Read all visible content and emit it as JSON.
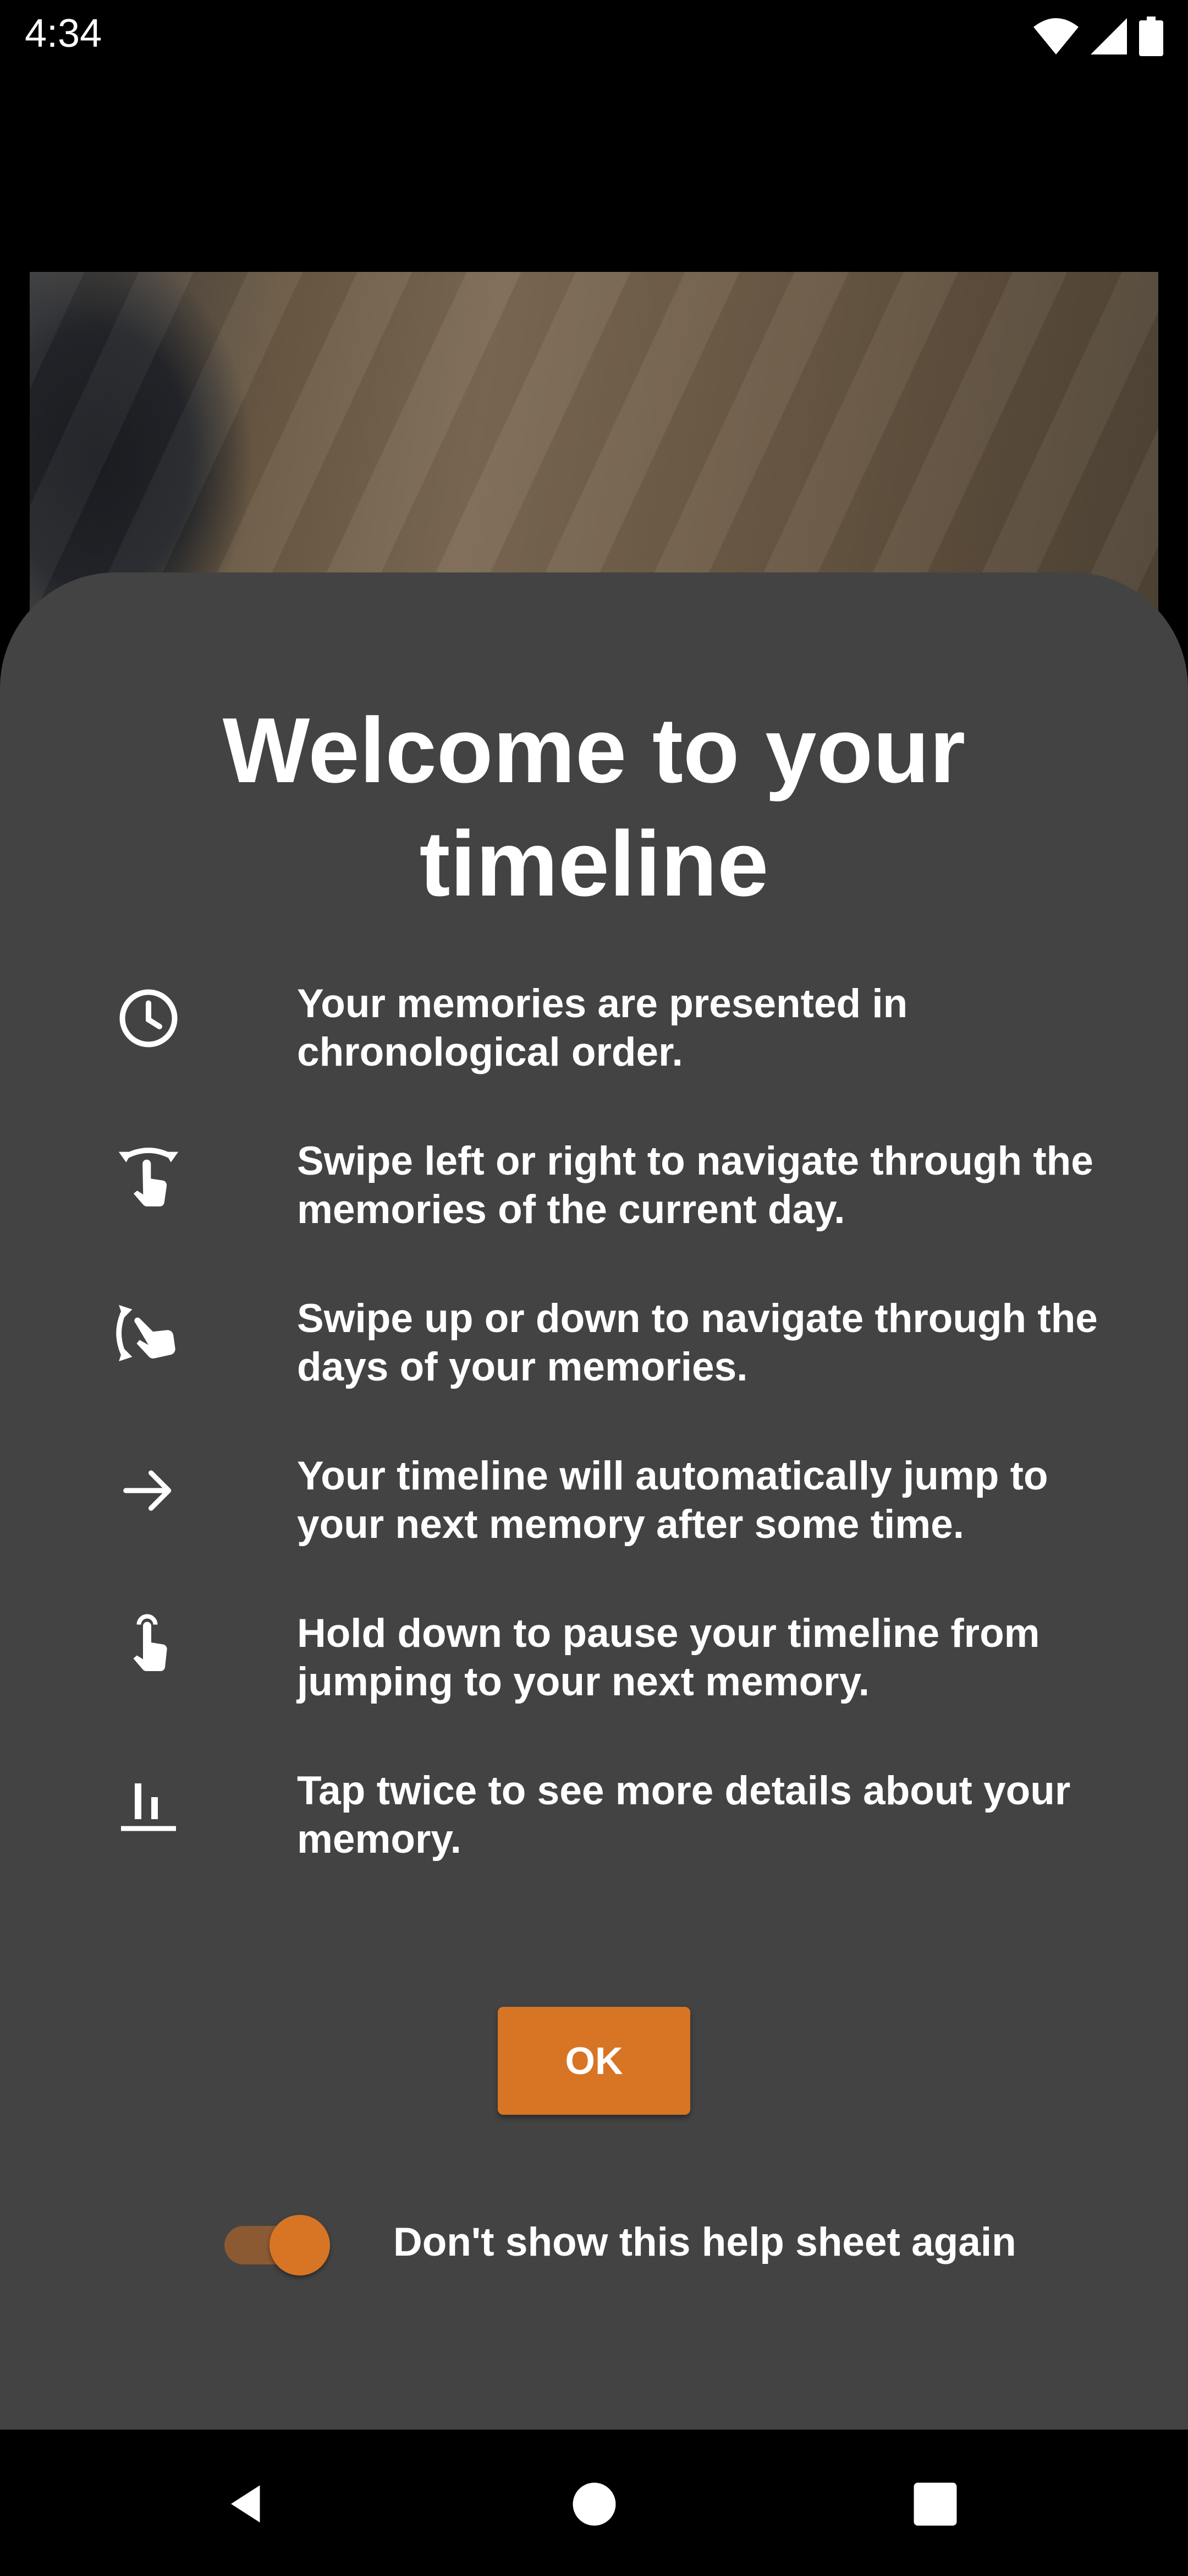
{
  "status_bar": {
    "time": "4:34"
  },
  "sheet": {
    "title_line1": "Welcome to your",
    "title_line2": "timeline",
    "items": [
      {
        "icon": "clock-icon",
        "line1": "Your memories are presented in",
        "line2": "chronological order."
      },
      {
        "icon": "swipe-horizontal-icon",
        "line1": "Swipe left or right to navigate through the",
        "line2": "memories of the current day."
      },
      {
        "icon": "swipe-vertical-icon",
        "line1": "Swipe up or down to navigate through the",
        "line2": "days of your memories."
      },
      {
        "icon": "arrow-right-icon",
        "line1": "Your timeline will automatically jump to",
        "line2": "your next memory after some time."
      },
      {
        "icon": "touch-hold-icon",
        "line1": "Hold down to pause your timeline from",
        "line2": "jumping to your next memory."
      },
      {
        "icon": "bar-chart-icon",
        "line1": "Tap twice to see more details about your",
        "line2": "memory."
      }
    ],
    "ok_label": "OK",
    "dont_show_label": "Don't show this help sheet again",
    "dont_show_enabled": true
  },
  "colors": {
    "accent": "#d87524",
    "sheet_background": "#434343",
    "background": "#000000",
    "text": "#ffffff"
  }
}
